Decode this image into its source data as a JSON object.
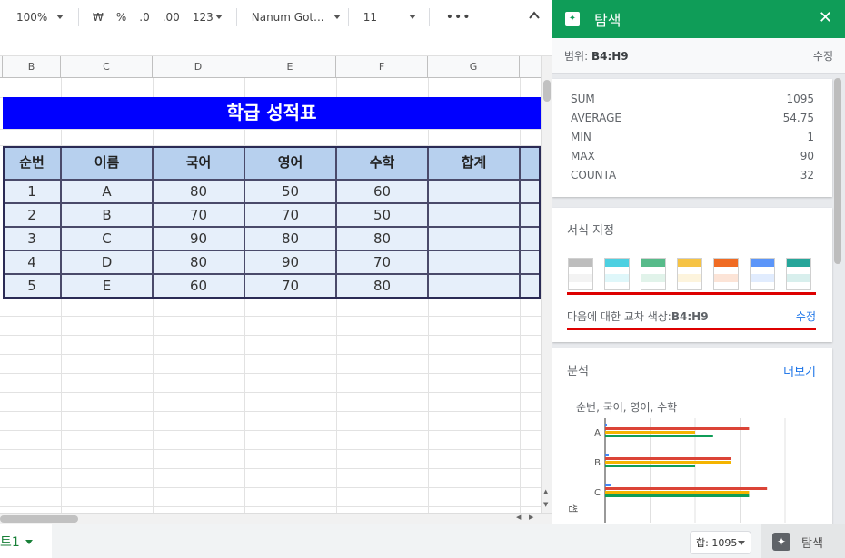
{
  "toolbar": {
    "zoom": "100%",
    "currency": "₩",
    "percent": "%",
    "dec_decrease": ".0",
    "dec_increase": ".00",
    "number_format": "123",
    "font": "Nanum Got...",
    "font_size": "11",
    "more": "•••"
  },
  "columns": [
    "B",
    "C",
    "D",
    "E",
    "F",
    "G"
  ],
  "sheet": {
    "title": "학급 성적표",
    "headers": [
      "순번",
      "이름",
      "국어",
      "영어",
      "수학",
      "합계"
    ],
    "rows": [
      [
        "1",
        "A",
        "80",
        "50",
        "60",
        ""
      ],
      [
        "2",
        "B",
        "70",
        "70",
        "50",
        ""
      ],
      [
        "3",
        "C",
        "90",
        "80",
        "80",
        ""
      ],
      [
        "4",
        "D",
        "80",
        "90",
        "70",
        ""
      ],
      [
        "5",
        "E",
        "60",
        "70",
        "80",
        ""
      ]
    ]
  },
  "bottom": {
    "sheet_tab": "트1",
    "sum_chip": "합: 1095",
    "explore_label": "탐색"
  },
  "panel": {
    "title": "탐색",
    "range_label": "범위:",
    "range_value": "B4:H9",
    "range_edit": "수정",
    "stats": [
      {
        "name": "SUM",
        "value": "1095"
      },
      {
        "name": "AVERAGE",
        "value": "54.75"
      },
      {
        "name": "MIN",
        "value": "1"
      },
      {
        "name": "MAX",
        "value": "90"
      },
      {
        "name": "COUNTA",
        "value": "32"
      }
    ],
    "format_title": "서식 지정",
    "swatch_colors": [
      "#bdbdbd",
      "#4dd0e1",
      "#57bb8a",
      "#f6c344",
      "#f06b23",
      "#5b95f9",
      "#26a69a"
    ],
    "alt_colors_text": "다음에 대한 교차 색상:",
    "alt_colors_range": "B4:H9",
    "alt_colors_edit": "수정",
    "analysis_title": "분석",
    "analysis_more": "더보기",
    "analysis_y_label": "썸",
    "chart_title": "순번, 국어, 영어, 수학"
  },
  "chart_data": {
    "type": "bar",
    "orientation": "horizontal",
    "title": "순번, 국어, 영어, 수학",
    "categories": [
      "A",
      "B",
      "C"
    ],
    "series": [
      {
        "name": "순번",
        "color": "#4285f4",
        "values": [
          1,
          2,
          3
        ]
      },
      {
        "name": "국어",
        "color": "#db4437",
        "values": [
          80,
          70,
          90
        ]
      },
      {
        "name": "영어",
        "color": "#f4b400",
        "values": [
          50,
          70,
          80
        ]
      },
      {
        "name": "수학",
        "color": "#0f9d58",
        "values": [
          60,
          50,
          80
        ]
      }
    ],
    "xlim": [
      0,
      100
    ],
    "grid": true
  }
}
